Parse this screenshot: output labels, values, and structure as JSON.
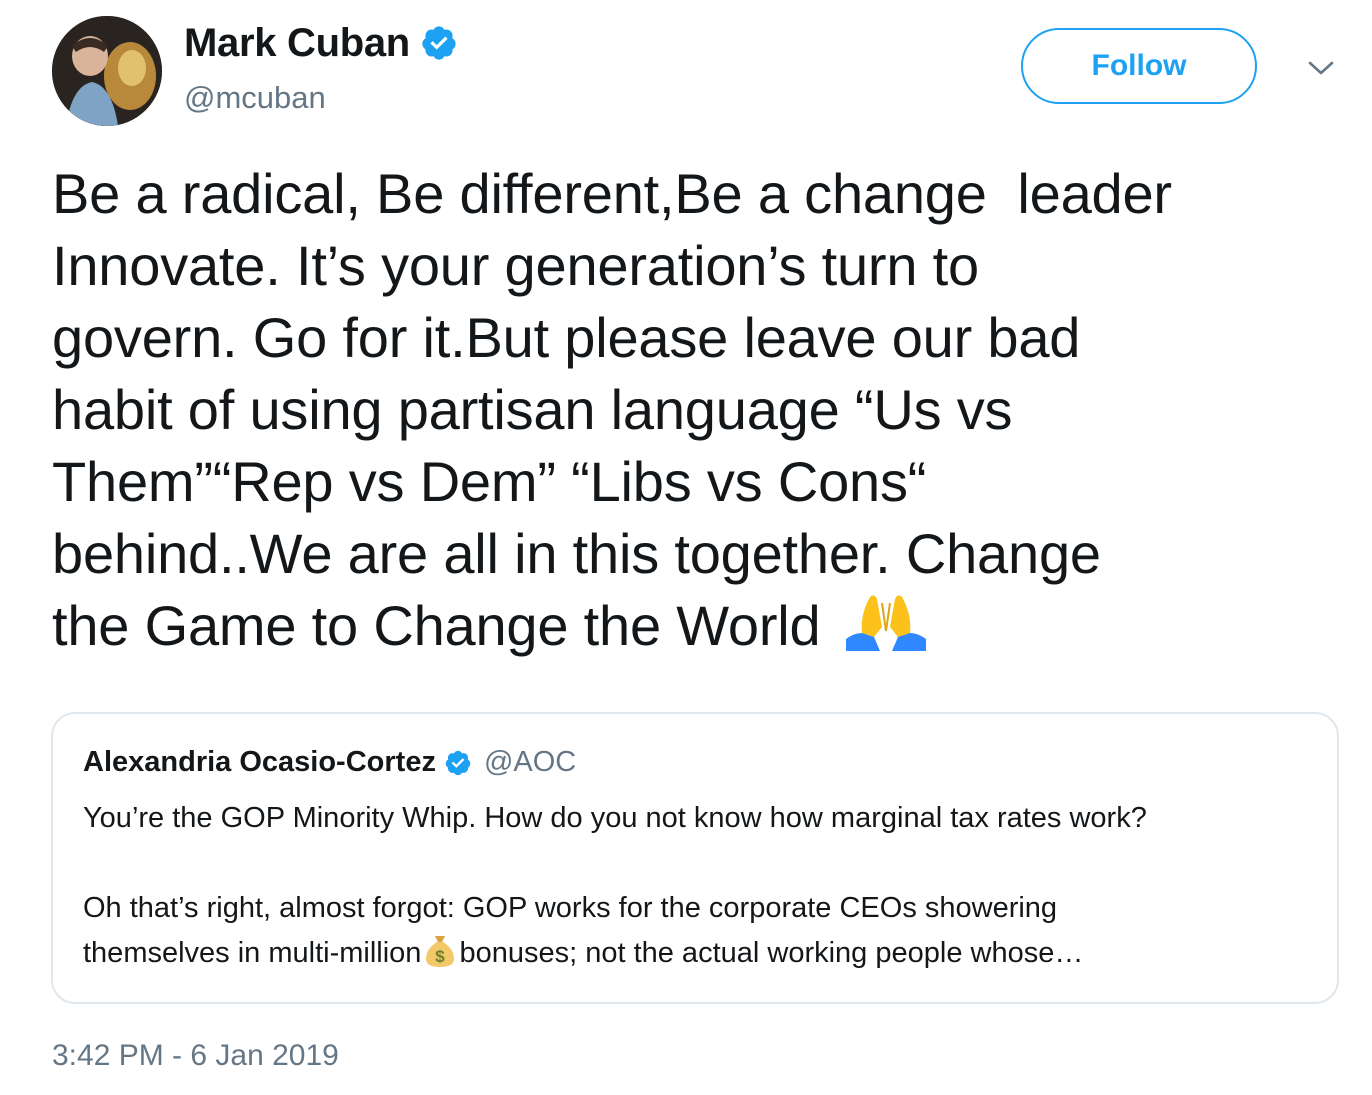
{
  "author": {
    "display_name": "Mark Cuban",
    "handle": "@mcuban",
    "verified": true,
    "avatar_icon": "user-avatar-photo"
  },
  "actions": {
    "follow_label": "Follow",
    "more_icon": "chevron-down-icon"
  },
  "tweet": {
    "lines": [
      "Be a radical, Be different,Be a change  leader",
      "Innovate. It’s your generation’s turn to",
      "govern. Go for it.But please leave our bad",
      "habit of using partisan language “Us vs",
      "Them”“Rep vs Dem” “Libs vs Cons“",
      "behind..We are all in this together. Change",
      "the Game to Change the World"
    ],
    "trailing_emoji": "folded-hands-emoji"
  },
  "quoted_tweet": {
    "display_name": "Alexandria Ocasio-Cortez",
    "handle": "@AOC",
    "verified": true,
    "paragraph_1": "You’re the GOP Minority Whip. How do you not know how marginal tax rates work?",
    "paragraph_2_line_1": "Oh that’s right, almost forgot: GOP works for the corporate CEOs showering",
    "paragraph_2_line_2_before": "themselves in multi-million",
    "paragraph_2_emoji": "money-bag-emoji",
    "paragraph_2_line_2_after": "bonuses; not the actual working people whose…"
  },
  "timestamp": "3:42 PM - 6 Jan 2019",
  "colors": {
    "accent": "#1da1f2",
    "text": "#14171a",
    "secondary_text": "#657786",
    "border": "#e1e8ed"
  }
}
